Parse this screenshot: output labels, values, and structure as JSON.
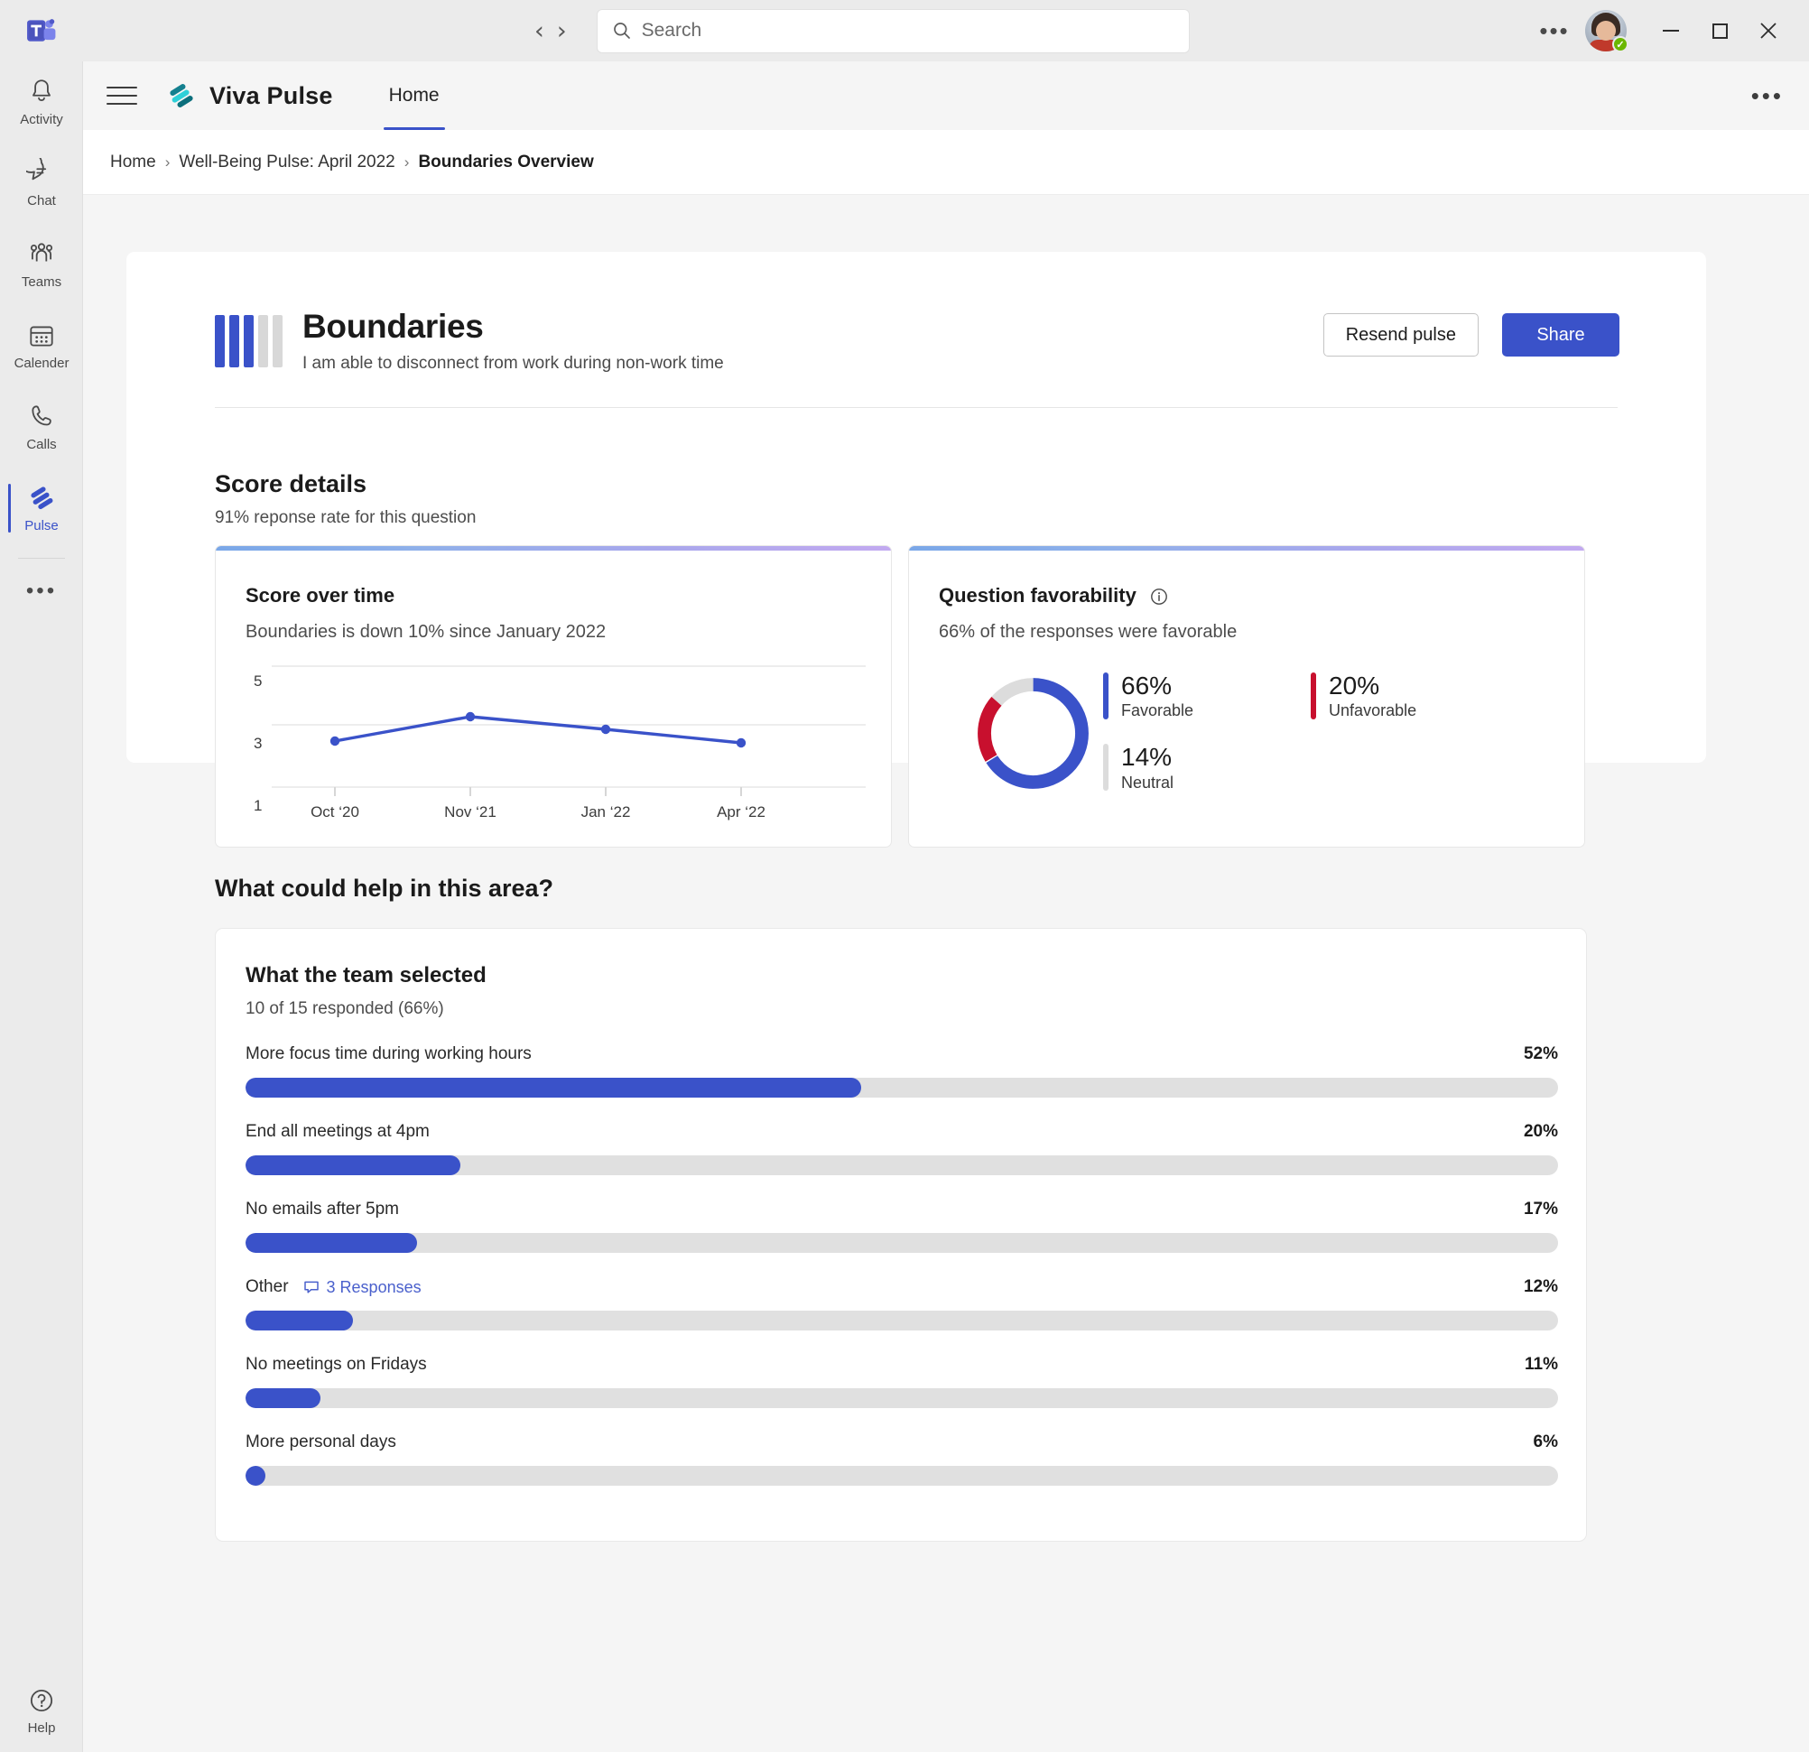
{
  "titlebar": {
    "app_logo": "microsoft-teams-logo",
    "back_label": "‹",
    "forward_label": "›",
    "search_placeholder": "Search",
    "more_label": "•••",
    "presence": "available",
    "minimize_label": "–",
    "maximize_label": "□",
    "close_label": "✕"
  },
  "rail": {
    "items": [
      {
        "label": "Activity",
        "icon": "bell-icon",
        "active": false
      },
      {
        "label": "Chat",
        "icon": "chat-icon",
        "active": false
      },
      {
        "label": "Teams",
        "icon": "teams-icon",
        "active": false
      },
      {
        "label": "Calender",
        "icon": "calendar-icon",
        "active": false
      },
      {
        "label": "Calls",
        "icon": "phone-icon",
        "active": false
      },
      {
        "label": "Pulse",
        "icon": "viva-pulse-icon",
        "active": true
      }
    ],
    "more_label": "•••",
    "help_label": "Help"
  },
  "appheader": {
    "menu_label": "hamburger-menu",
    "brand_name": "Viva  Pulse",
    "tab_label": "Home",
    "more_label": "•••"
  },
  "breadcrumb": {
    "items": [
      "Home",
      "Well-Being Pulse: April 2022",
      "Boundaries Overview"
    ],
    "separator": "›"
  },
  "question": {
    "title": "Boundaries",
    "subtitle": "I am able to disconnect from work during non-work time",
    "rating_filled": 3,
    "rating_total": 5,
    "resend_label": "Resend pulse",
    "share_label": "Share"
  },
  "score_details": {
    "title": "Score details",
    "subtitle": "91% reponse rate for this question"
  },
  "colors": {
    "accent": "#3a52c9",
    "favorable": "#3a52c9",
    "unfavorable": "#c8102e",
    "neutral": "#dcdcdc",
    "track": "#e0e0e0"
  },
  "score_card": {
    "title": "Score over time",
    "subtitle": "Boundaries is down 10% since January 2022"
  },
  "favorability_card": {
    "title": "Question favorability",
    "info_icon": "info-icon",
    "subtitle": "66% of the responses were favorable",
    "legend": [
      {
        "pct": "66%",
        "label": "Favorable",
        "color": "#3a52c9"
      },
      {
        "pct": "20%",
        "label": "Unfavorable",
        "color": "#c8102e"
      },
      {
        "pct": "14%",
        "label": "Neutral",
        "color": "#dcdcdc"
      }
    ]
  },
  "help_section": {
    "title": "What could help in this area?",
    "card_title": "What the team selected",
    "card_subtitle": "10 of 15 responded (66%)",
    "responses_link": "3 Responses"
  },
  "chart_data": [
    {
      "type": "line",
      "title": "Score over time",
      "subtitle": "Boundaries is down 10% since January 2022",
      "x": [
        "Oct '20",
        "Nov '21",
        "Jan '22",
        "Apr '22"
      ],
      "values": [
        3.15,
        4.35,
        3.85,
        3.1
      ],
      "ytick_labels": [
        "5",
        "3",
        "1"
      ],
      "ytick_values": [
        5,
        3,
        1
      ],
      "ylim": [
        1,
        5.6
      ],
      "gridlines": [
        5.6,
        3.45,
        1.0
      ],
      "xlabel": "",
      "ylabel": "",
      "series_color": "#3a52c9",
      "legend": "none",
      "grid": true
    },
    {
      "type": "pie",
      "title": "Question favorability",
      "subtitle": "66% of the responses were favorable",
      "labels": [
        "Favorable",
        "Unfavorable",
        "Neutral"
      ],
      "values": [
        66,
        20,
        14
      ],
      "colors": [
        "#3a52c9",
        "#c8102e",
        "#dcdcdc"
      ],
      "donut": true,
      "start_angle_deg": 0,
      "direction": "clockwise",
      "legend": "right"
    },
    {
      "type": "bar",
      "orientation": "horizontal",
      "title": "What the team selected",
      "subtitle": "10 of 15 responded (66%)",
      "categories": [
        "More focus time during working hours",
        "End all meetings at 4pm",
        "No emails after 5pm",
        "Other",
        "No meetings on Fridays",
        "More personal days"
      ],
      "values": [
        52,
        20,
        17,
        12,
        11,
        6
      ],
      "value_labels": [
        "52%",
        "20%",
        "17%",
        "12%",
        "11%",
        "6%"
      ],
      "bar_fill_fraction": [
        0.42,
        0.162,
        0.129,
        0.081,
        0.056,
        0.012
      ],
      "bar_color": "#3a52c9",
      "track_color": "#e0e0e0",
      "xlim": [
        0,
        100
      ],
      "grid": false,
      "legend": "none"
    }
  ]
}
